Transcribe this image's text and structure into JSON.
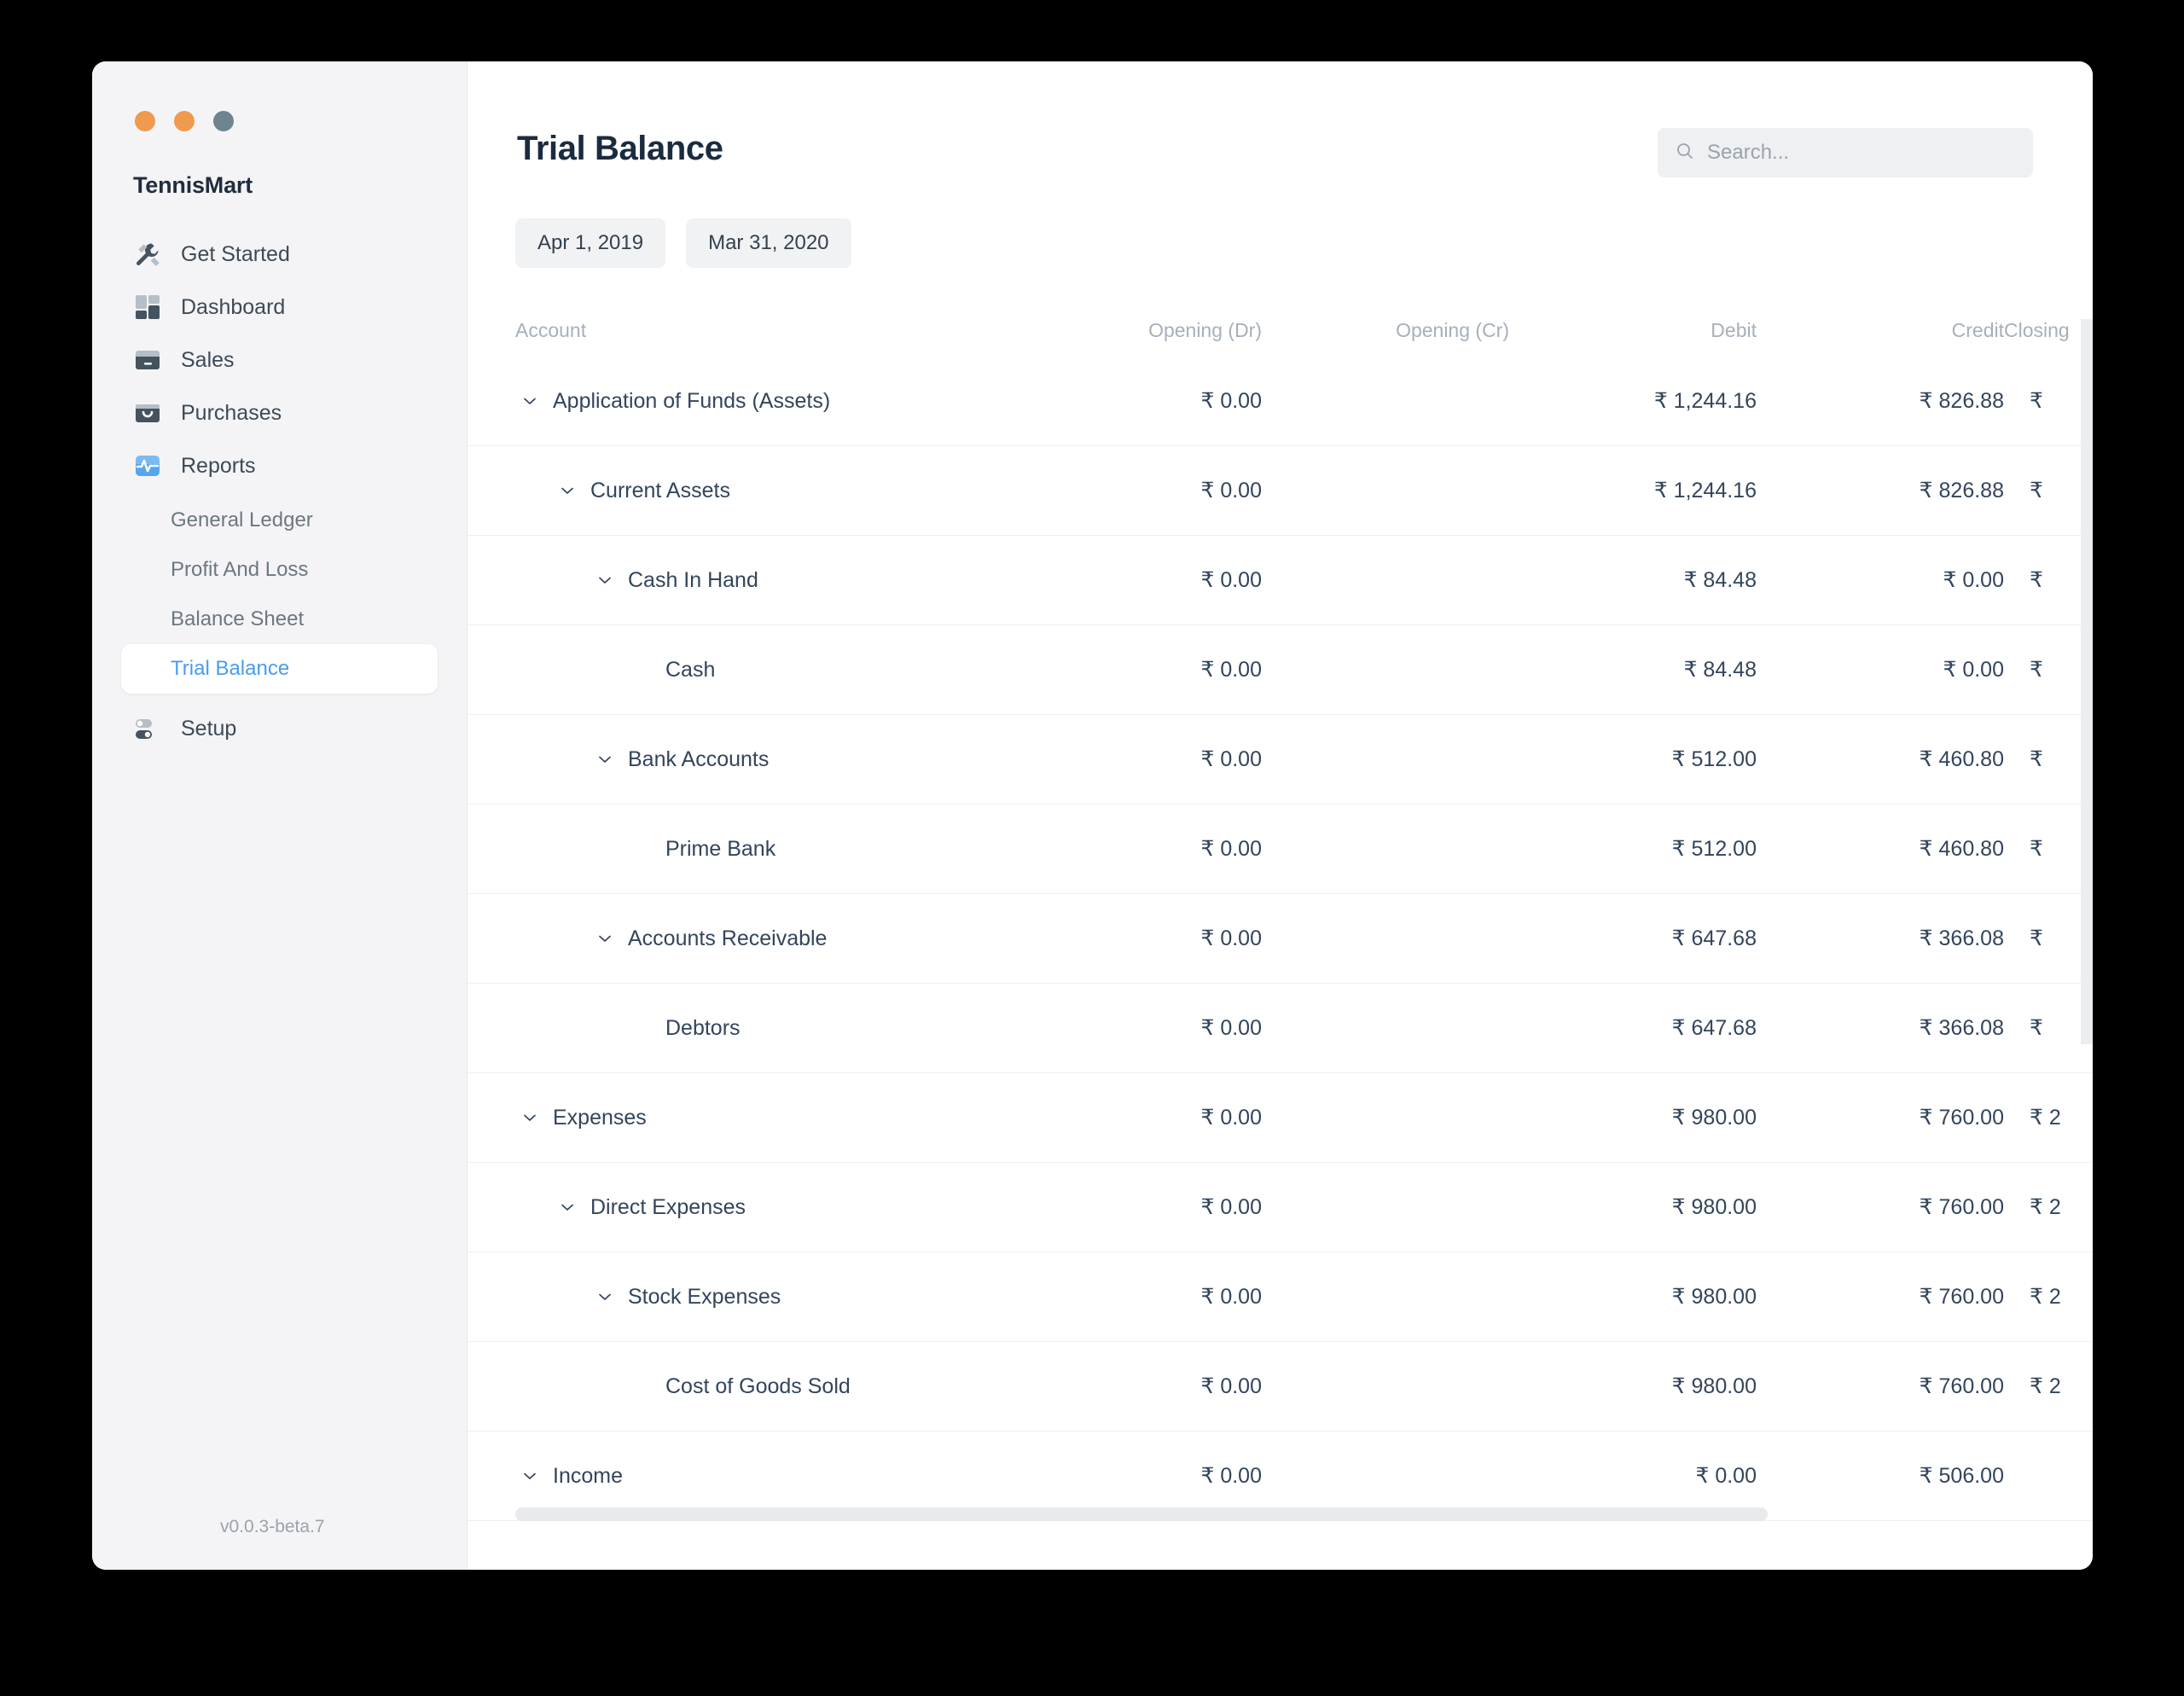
{
  "window": {
    "traffic_lights": [
      "close",
      "minimize",
      "maximize"
    ]
  },
  "sidebar": {
    "brand": "TennisMart",
    "version": "v0.0.3-beta.7",
    "items": [
      {
        "label": "Get Started",
        "icon": "wrench-icon"
      },
      {
        "label": "Dashboard",
        "icon": "dashboard-grid-icon"
      },
      {
        "label": "Sales",
        "icon": "card-icon"
      },
      {
        "label": "Purchases",
        "icon": "bag-icon"
      },
      {
        "label": "Reports",
        "icon": "chart-pulse-icon"
      },
      {
        "label": "Setup",
        "icon": "sliders-icon"
      }
    ],
    "sub_items": [
      {
        "label": "General Ledger",
        "active": false
      },
      {
        "label": "Profit And Loss",
        "active": false
      },
      {
        "label": "Balance Sheet",
        "active": false
      },
      {
        "label": "Trial Balance",
        "active": true
      }
    ]
  },
  "header": {
    "title": "Trial Balance"
  },
  "search": {
    "placeholder": "Search...",
    "value": "",
    "icon": "search-icon"
  },
  "filters": {
    "from_date": "Apr 1, 2019",
    "to_date": "Mar 31, 2020"
  },
  "table": {
    "columns": [
      "Account",
      "Opening (Dr)",
      "Opening (Cr)",
      "Debit",
      "Credit",
      "Closing"
    ],
    "rows": [
      {
        "account": "Application of Funds (Assets)",
        "level": 0,
        "expandable": true,
        "opening_dr": "₹ 0.00",
        "opening_cr": "",
        "debit": "₹ 1,244.16",
        "credit": "₹ 826.88",
        "closing": "₹"
      },
      {
        "account": "Current Assets",
        "level": 1,
        "expandable": true,
        "opening_dr": "₹ 0.00",
        "opening_cr": "",
        "debit": "₹ 1,244.16",
        "credit": "₹ 826.88",
        "closing": "₹"
      },
      {
        "account": "Cash In Hand",
        "level": 2,
        "expandable": true,
        "opening_dr": "₹ 0.00",
        "opening_cr": "",
        "debit": "₹ 84.48",
        "credit": "₹ 0.00",
        "closing": "₹"
      },
      {
        "account": "Cash",
        "level": 3,
        "expandable": false,
        "opening_dr": "₹ 0.00",
        "opening_cr": "",
        "debit": "₹ 84.48",
        "credit": "₹ 0.00",
        "closing": "₹"
      },
      {
        "account": "Bank Accounts",
        "level": 2,
        "expandable": true,
        "opening_dr": "₹ 0.00",
        "opening_cr": "",
        "debit": "₹ 512.00",
        "credit": "₹ 460.80",
        "closing": "₹"
      },
      {
        "account": "Prime Bank",
        "level": 3,
        "expandable": false,
        "opening_dr": "₹ 0.00",
        "opening_cr": "",
        "debit": "₹ 512.00",
        "credit": "₹ 460.80",
        "closing": "₹"
      },
      {
        "account": "Accounts Receivable",
        "level": 2,
        "expandable": true,
        "opening_dr": "₹ 0.00",
        "opening_cr": "",
        "debit": "₹ 647.68",
        "credit": "₹ 366.08",
        "closing": "₹"
      },
      {
        "account": "Debtors",
        "level": 3,
        "expandable": false,
        "opening_dr": "₹ 0.00",
        "opening_cr": "",
        "debit": "₹ 647.68",
        "credit": "₹ 366.08",
        "closing": "₹"
      },
      {
        "account": "Expenses",
        "level": 0,
        "expandable": true,
        "opening_dr": "₹ 0.00",
        "opening_cr": "",
        "debit": "₹ 980.00",
        "credit": "₹ 760.00",
        "closing": "₹ 2"
      },
      {
        "account": "Direct Expenses",
        "level": 1,
        "expandable": true,
        "opening_dr": "₹ 0.00",
        "opening_cr": "",
        "debit": "₹ 980.00",
        "credit": "₹ 760.00",
        "closing": "₹ 2"
      },
      {
        "account": "Stock Expenses",
        "level": 2,
        "expandable": true,
        "opening_dr": "₹ 0.00",
        "opening_cr": "",
        "debit": "₹ 980.00",
        "credit": "₹ 760.00",
        "closing": "₹ 2"
      },
      {
        "account": "Cost of Goods Sold",
        "level": 3,
        "expandable": false,
        "opening_dr": "₹ 0.00",
        "opening_cr": "",
        "debit": "₹ 980.00",
        "credit": "₹ 760.00",
        "closing": "₹ 2"
      },
      {
        "account": "Income",
        "level": 0,
        "expandable": true,
        "opening_dr": "₹ 0.00",
        "opening_cr": "",
        "debit": "₹ 0.00",
        "credit": "₹ 506.00",
        "closing": ""
      }
    ]
  },
  "colors": {
    "accent": "#4a9ced",
    "text": "#33455c",
    "muted": "#a6b0bb",
    "sidebar_bg": "#f4f4f6",
    "icon_dark": "#44535f"
  }
}
